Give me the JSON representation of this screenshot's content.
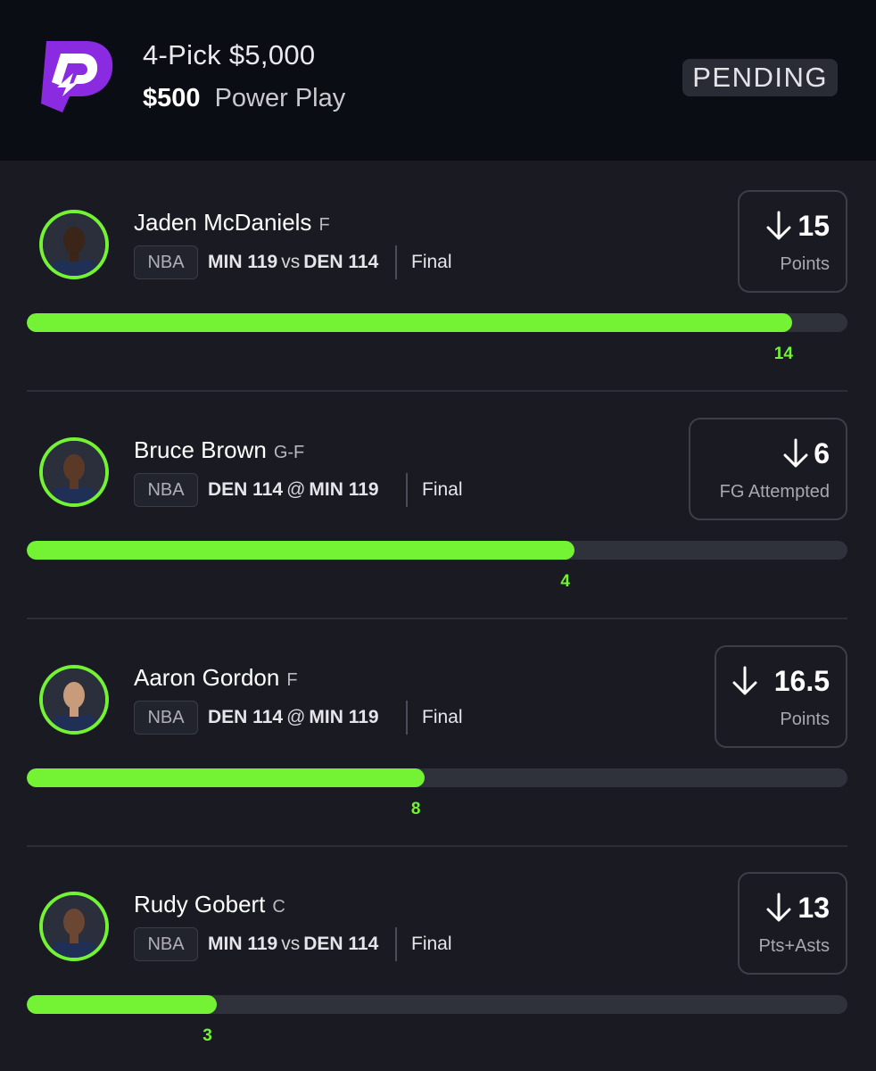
{
  "header": {
    "title": "4-Pick $5,000",
    "entry_amount": "$500",
    "play_type": "Power Play",
    "status": "PENDING",
    "accent_color": "#8a2be2"
  },
  "picks": [
    {
      "player": "Jaden McDaniels",
      "position": "F",
      "league": "NBA",
      "team": "MIN 119",
      "separator": "vs",
      "opponent": "DEN 114",
      "game_status": "Final",
      "direction": "down-arrow-icon",
      "line": "15",
      "stat": "Points",
      "actual": "14",
      "progress": 0.933
    },
    {
      "player": "Bruce Brown",
      "position": "G-F",
      "league": "NBA",
      "team": "DEN 114",
      "separator": "@",
      "opponent": "MIN 119",
      "game_status": "Final",
      "direction": "down-arrow-icon",
      "line": "6",
      "stat": "FG Attempted",
      "actual": "4",
      "progress": 0.667
    },
    {
      "player": "Aaron Gordon",
      "position": "F",
      "league": "NBA",
      "team": "DEN 114",
      "separator": "@",
      "opponent": "MIN 119",
      "game_status": "Final",
      "direction": "down-arrow-icon",
      "line": "16.5",
      "stat": "Points",
      "actual": "8",
      "progress": 0.485
    },
    {
      "player": "Rudy Gobert",
      "position": "C",
      "league": "NBA",
      "team": "MIN 119",
      "separator": "vs",
      "opponent": "DEN 114",
      "game_status": "Final",
      "direction": "down-arrow-icon",
      "line": "13",
      "stat": "Pts+Asts",
      "actual": "3",
      "progress": 0.231
    }
  ],
  "colors": {
    "progress_fill": "#73f334",
    "background": "#191a22",
    "header_background": "#0b0d14"
  }
}
